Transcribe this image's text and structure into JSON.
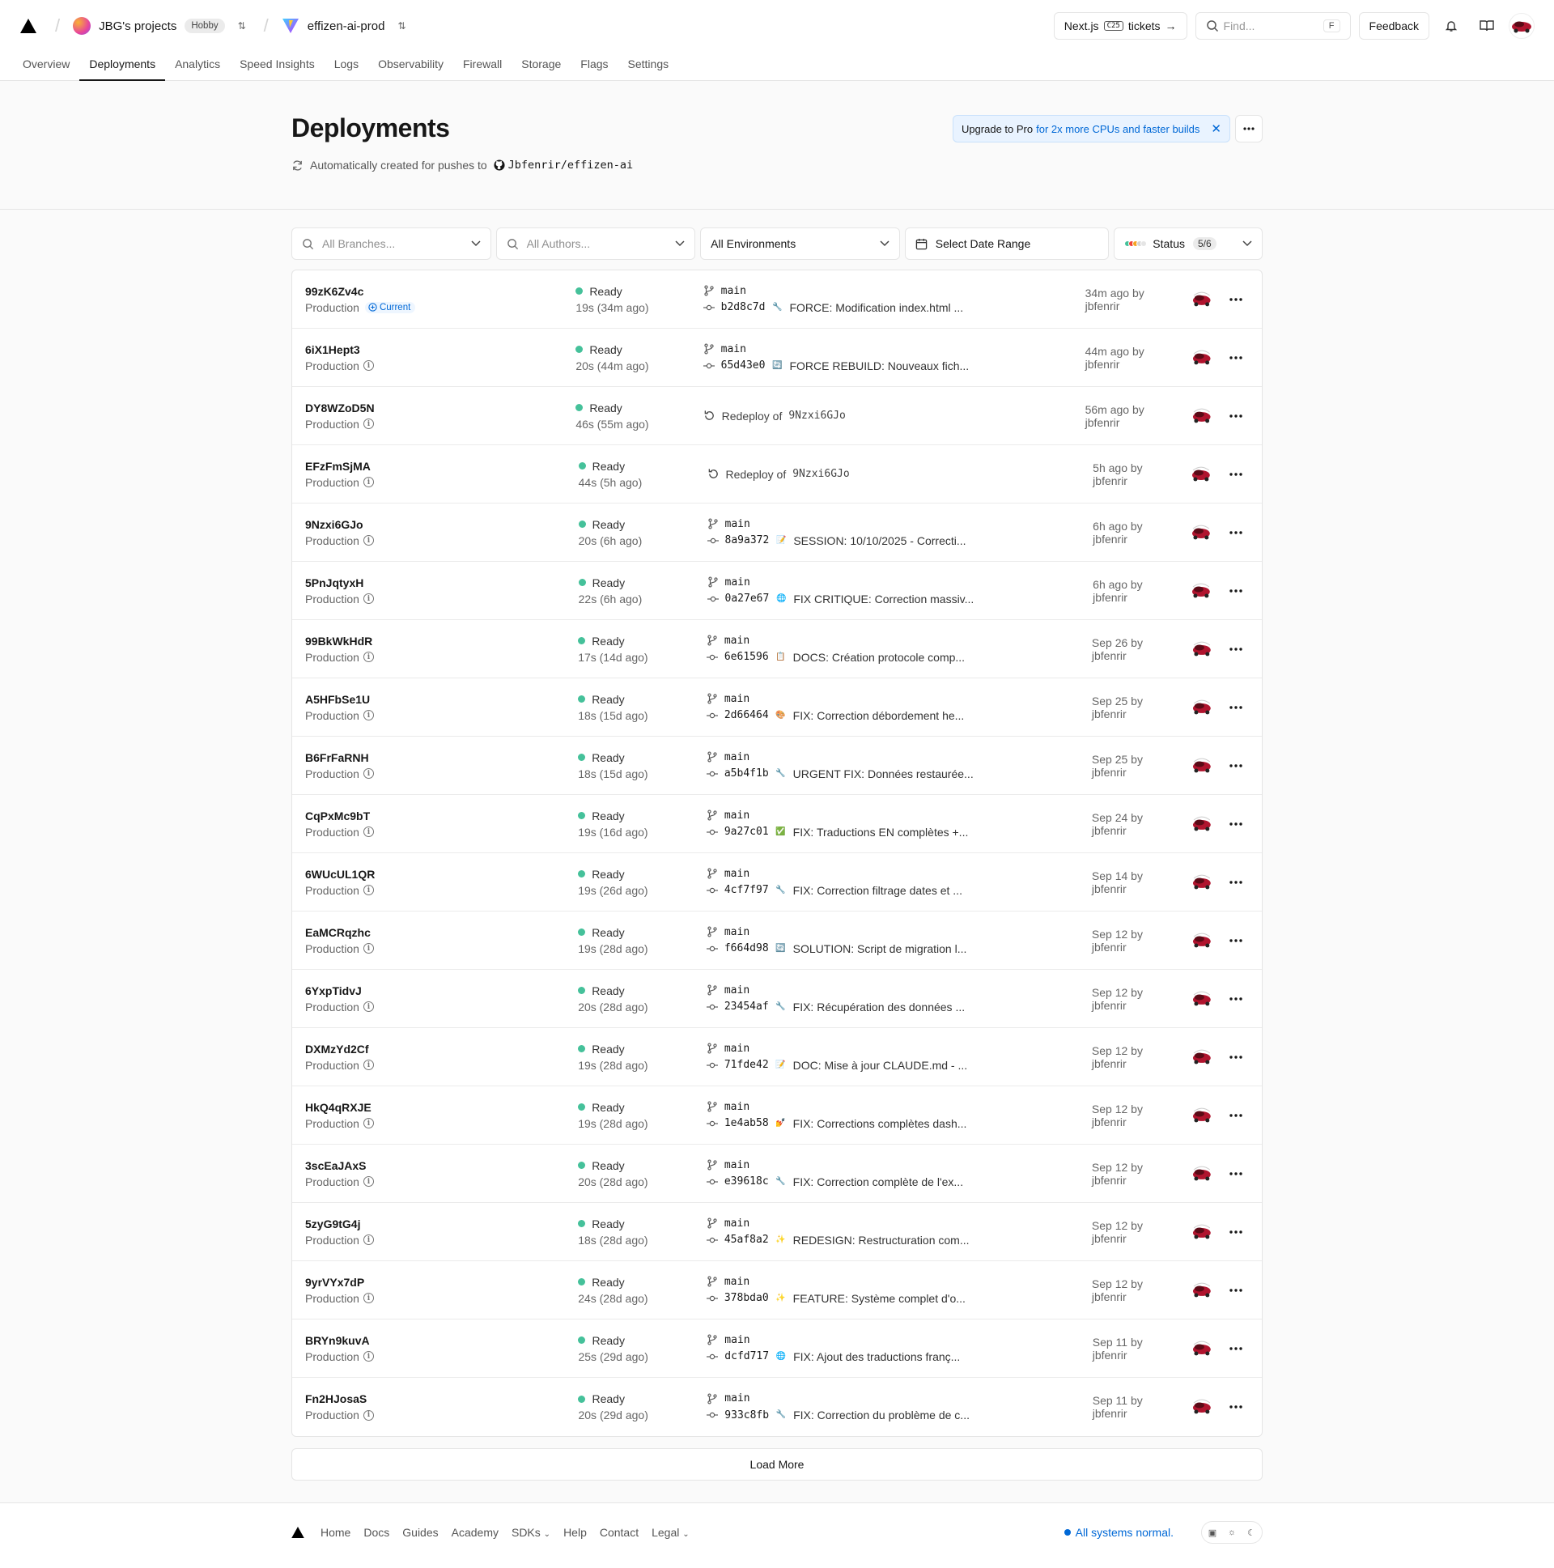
{
  "header": {
    "team": "JBG's projects",
    "plan": "Hobby",
    "project": "effizen-ai-prod",
    "nextjs_label_pre": "Next.js",
    "nextjs_badge": "C25",
    "nextjs_label_post": "tickets",
    "find_placeholder": "Find...",
    "find_key": "F",
    "feedback": "Feedback"
  },
  "tabs": [
    "Overview",
    "Deployments",
    "Analytics",
    "Speed Insights",
    "Logs",
    "Observability",
    "Firewall",
    "Storage",
    "Flags",
    "Settings"
  ],
  "active_tab": "Deployments",
  "page": {
    "title": "Deployments",
    "subtitle": "Automatically created for pushes to",
    "repo": "Jbfenrir/effizen-ai",
    "upgrade_strong": "Upgrade to Pro",
    "upgrade_rest": "for 2x more CPUs and faster builds"
  },
  "filters": {
    "branches": "All Branches...",
    "authors": "All Authors...",
    "environments": "All Environments",
    "date": "Select Date Range",
    "status": "Status",
    "status_count": "5/6"
  },
  "current_label": "Current",
  "deployments": [
    {
      "id": "99zK6Zv4c",
      "env": "Production",
      "current": true,
      "status": "Ready",
      "duration": "19s (34m ago)",
      "type": "commit",
      "branch": "main",
      "sha": "b2d8c7d",
      "emoji": "🔧",
      "message": "FORCE: Modification index.html ...",
      "meta": "34m ago by jbfenrir"
    },
    {
      "id": "6iX1Hept3",
      "env": "Production",
      "current": false,
      "status": "Ready",
      "duration": "20s (44m ago)",
      "type": "commit",
      "branch": "main",
      "sha": "65d43e0",
      "emoji": "🔄",
      "message": "FORCE REBUILD: Nouveaux fich...",
      "meta": "44m ago by jbfenrir"
    },
    {
      "id": "DY8WZoD5N",
      "env": "Production",
      "current": false,
      "status": "Ready",
      "duration": "46s (55m ago)",
      "type": "redeploy",
      "redeploy_label": "Redeploy of",
      "redeploy_of": "9Nzxi6GJo",
      "meta": "56m ago by jbfenrir"
    },
    {
      "id": "EFzFmSjMA",
      "env": "Production",
      "current": false,
      "status": "Ready",
      "duration": "44s (5h ago)",
      "type": "redeploy",
      "redeploy_label": "Redeploy of",
      "redeploy_of": "9Nzxi6GJo",
      "meta": "5h ago by jbfenrir"
    },
    {
      "id": "9Nzxi6GJo",
      "env": "Production",
      "current": false,
      "status": "Ready",
      "duration": "20s (6h ago)",
      "type": "commit",
      "branch": "main",
      "sha": "8a9a372",
      "emoji": "📝",
      "message": "SESSION: 10/10/2025 - Correcti...",
      "meta": "6h ago by jbfenrir"
    },
    {
      "id": "5PnJqtyxH",
      "env": "Production",
      "current": false,
      "status": "Ready",
      "duration": "22s (6h ago)",
      "type": "commit",
      "branch": "main",
      "sha": "0a27e67",
      "emoji": "🌐",
      "message": "FIX CRITIQUE: Correction massiv...",
      "meta": "6h ago by jbfenrir"
    },
    {
      "id": "99BkWkHdR",
      "env": "Production",
      "current": false,
      "status": "Ready",
      "duration": "17s (14d ago)",
      "type": "commit",
      "branch": "main",
      "sha": "6e61596",
      "emoji": "📋",
      "message": "DOCS: Création protocole comp...",
      "meta": "Sep 26 by jbfenrir"
    },
    {
      "id": "A5HFbSe1U",
      "env": "Production",
      "current": false,
      "status": "Ready",
      "duration": "18s (15d ago)",
      "type": "commit",
      "branch": "main",
      "sha": "2d66464",
      "emoji": "🎨",
      "message": "FIX: Correction débordement he...",
      "meta": "Sep 25 by jbfenrir"
    },
    {
      "id": "B6FrFaRNH",
      "env": "Production",
      "current": false,
      "status": "Ready",
      "duration": "18s (15d ago)",
      "type": "commit",
      "branch": "main",
      "sha": "a5b4f1b",
      "emoji": "🔧",
      "message": "URGENT FIX: Données restaurée...",
      "meta": "Sep 25 by jbfenrir"
    },
    {
      "id": "CqPxMc9bT",
      "env": "Production",
      "current": false,
      "status": "Ready",
      "duration": "19s (16d ago)",
      "type": "commit",
      "branch": "main",
      "sha": "9a27c01",
      "emoji": "✅",
      "message": "FIX: Traductions EN complètes +...",
      "meta": "Sep 24 by jbfenrir"
    },
    {
      "id": "6WUcUL1QR",
      "env": "Production",
      "current": false,
      "status": "Ready",
      "duration": "19s (26d ago)",
      "type": "commit",
      "branch": "main",
      "sha": "4cf7f97",
      "emoji": "🔧",
      "message": "FIX: Correction filtrage dates et ...",
      "meta": "Sep 14 by jbfenrir"
    },
    {
      "id": "EaMCRqzhc",
      "env": "Production",
      "current": false,
      "status": "Ready",
      "duration": "19s (28d ago)",
      "type": "commit",
      "branch": "main",
      "sha": "f664d98",
      "emoji": "🔄",
      "message": "SOLUTION: Script de migration l...",
      "meta": "Sep 12 by jbfenrir"
    },
    {
      "id": "6YxpTidvJ",
      "env": "Production",
      "current": false,
      "status": "Ready",
      "duration": "20s (28d ago)",
      "type": "commit",
      "branch": "main",
      "sha": "23454af",
      "emoji": "🔧",
      "message": "FIX: Récupération des données ...",
      "meta": "Sep 12 by jbfenrir"
    },
    {
      "id": "DXMzYd2Cf",
      "env": "Production",
      "current": false,
      "status": "Ready",
      "duration": "19s (28d ago)",
      "type": "commit",
      "branch": "main",
      "sha": "71fde42",
      "emoji": "📝",
      "message": "DOC: Mise à jour CLAUDE.md - ...",
      "meta": "Sep 12 by jbfenrir"
    },
    {
      "id": "HkQ4qRXJE",
      "env": "Production",
      "current": false,
      "status": "Ready",
      "duration": "19s (28d ago)",
      "type": "commit",
      "branch": "main",
      "sha": "1e4ab58",
      "emoji": "💅",
      "message": "FIX: Corrections complètes dash...",
      "meta": "Sep 12 by jbfenrir"
    },
    {
      "id": "3scEaJAxS",
      "env": "Production",
      "current": false,
      "status": "Ready",
      "duration": "20s (28d ago)",
      "type": "commit",
      "branch": "main",
      "sha": "e39618c",
      "emoji": "🔧",
      "message": "FIX: Correction complète de l'ex...",
      "meta": "Sep 12 by jbfenrir"
    },
    {
      "id": "5zyG9tG4j",
      "env": "Production",
      "current": false,
      "status": "Ready",
      "duration": "18s (28d ago)",
      "type": "commit",
      "branch": "main",
      "sha": "45af8a2",
      "emoji": "✨",
      "message": "REDESIGN: Restructuration com...",
      "meta": "Sep 12 by jbfenrir"
    },
    {
      "id": "9yrVYx7dP",
      "env": "Production",
      "current": false,
      "status": "Ready",
      "duration": "24s (28d ago)",
      "type": "commit",
      "branch": "main",
      "sha": "378bda0",
      "emoji": "✨",
      "message": "FEATURE: Système complet d'o...",
      "meta": "Sep 12 by jbfenrir"
    },
    {
      "id": "BRYn9kuvA",
      "env": "Production",
      "current": false,
      "status": "Ready",
      "duration": "25s (29d ago)",
      "type": "commit",
      "branch": "main",
      "sha": "dcfd717",
      "emoji": "🌐",
      "message": "FIX: Ajout des traductions franç...",
      "meta": "Sep 11 by jbfenrir"
    },
    {
      "id": "Fn2HJosaS",
      "env": "Production",
      "current": false,
      "status": "Ready",
      "duration": "20s (29d ago)",
      "type": "commit",
      "branch": "main",
      "sha": "933c8fb",
      "emoji": "🔧",
      "message": "FIX: Correction du problème de c...",
      "meta": "Sep 11 by jbfenrir"
    }
  ],
  "load_more": "Load More",
  "footer": {
    "links": [
      "Home",
      "Docs",
      "Guides",
      "Academy",
      "SDKs",
      "Help",
      "Contact",
      "Legal"
    ],
    "status": "All systems normal."
  },
  "colors": {
    "ready": "#45c19a",
    "accent": "#0068d6"
  }
}
